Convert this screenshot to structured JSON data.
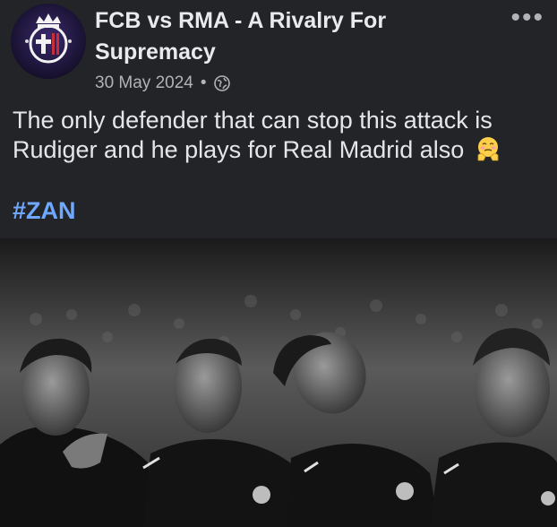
{
  "post": {
    "page_name": "FCB vs RMA - A Rivalry For Supremacy",
    "date": "30 May 2024",
    "separator": "•",
    "audience_icon": "globe-icon",
    "more_icon": "more-options-icon",
    "text": "The only defender that can stop this attack is Rudiger and he plays for Real Madrid also",
    "emoji": "face-holding-back-tears",
    "hashtag": "#ZAN",
    "photo_icon": "team-photo"
  },
  "colors": {
    "background": "#232427",
    "text": "#e4e6eb",
    "muted": "#b0b3b8",
    "hashtag": "#6ea8ff"
  }
}
